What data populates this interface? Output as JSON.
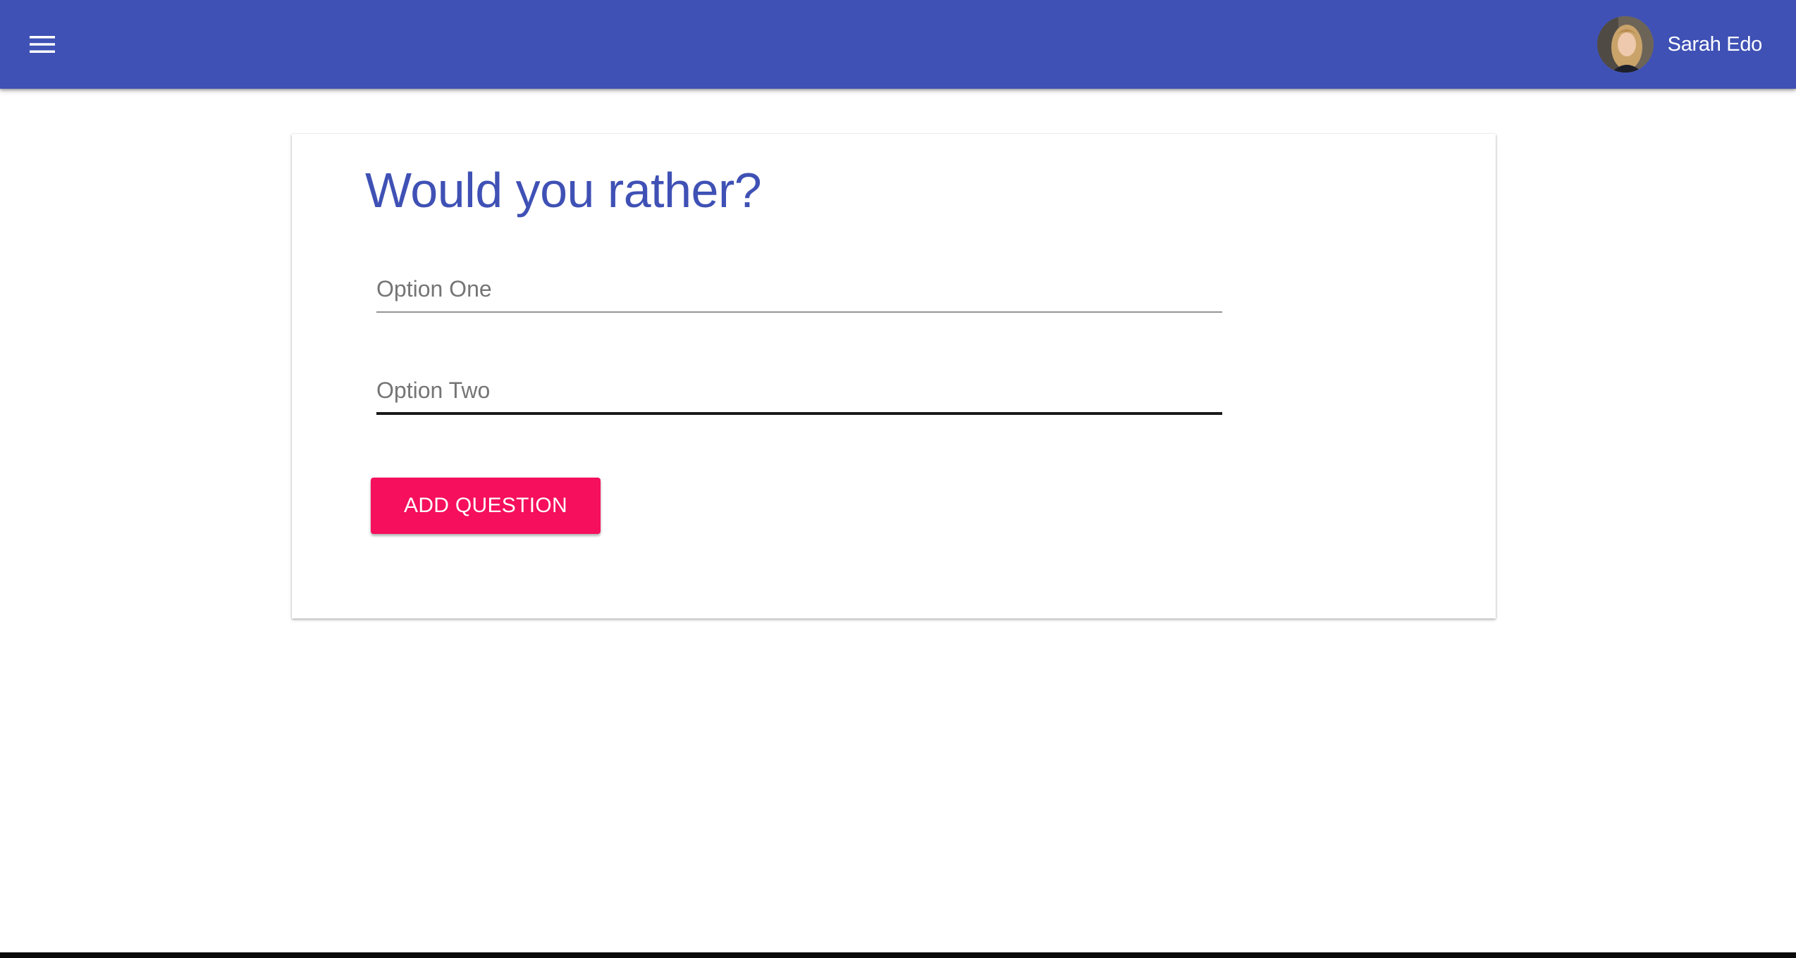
{
  "appbar": {
    "menu_icon": "hamburger-menu-icon",
    "user": {
      "name": "Sarah Edo",
      "avatar_icon": "user-avatar"
    },
    "color": "#3f51b5"
  },
  "card": {
    "title": "Would you rather?",
    "option_one": {
      "placeholder": "Option One",
      "value": ""
    },
    "option_two": {
      "placeholder": "Option Two",
      "value": ""
    },
    "submit_label": "ADD QUESTION",
    "accent_color": "#f50f5d"
  }
}
